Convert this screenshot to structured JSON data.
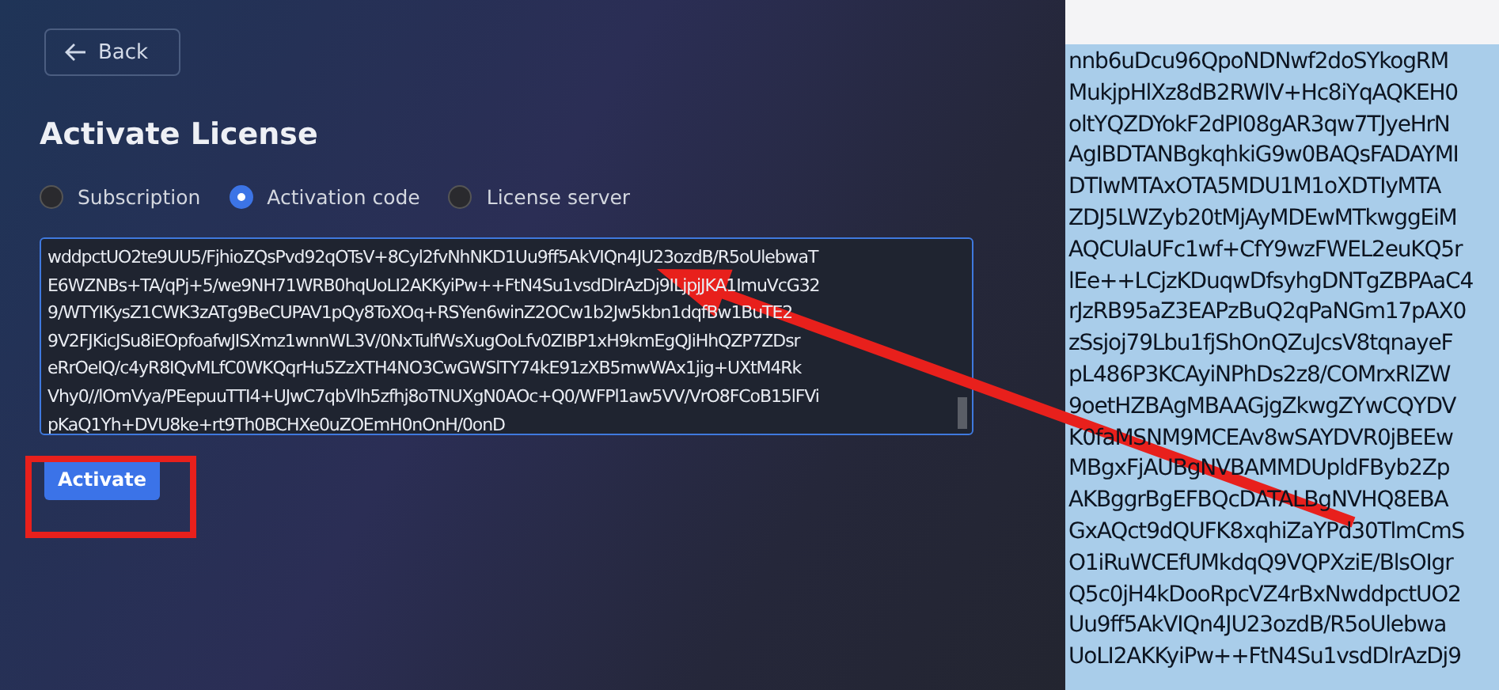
{
  "back_button": {
    "label": "Back"
  },
  "title": "Activate License",
  "license_options": [
    {
      "label": "Subscription",
      "selected": false
    },
    {
      "label": "Activation code",
      "selected": true
    },
    {
      "label": "License server",
      "selected": false
    }
  ],
  "activation_code_field": {
    "lines": [
      "wddpctUO2te9UU5/FjhioZQsPvd92qOTsV+8Cyl2fvNhNKD1Uu9ff5AkVIQn4JU23ozdB/R5oUlebwaT",
      "E6WZNBs+TA/qPj+5/we9NH71WRB0hqUoLI2AKKyiPw++FtN4Su1vsdDlrAzDj9ILjpjJKA1ImuVcG32",
      "9/WTYIKysZ1CWK3zATg9BeCUPAV1pQy8ToXOq+RSYen6winZ2OCw1b2Jw5kbn1dqfBw1BuTE2",
      "9V2FJKicJSu8iEOpfoafwJISXmz1wnnWL3V/0NxTulfWsXugOoLfv0ZIBP1xH9kmEgQJiHhQZP7ZDsr",
      "eRrOeIQ/c4yR8IQvMLfC0WKQqrHu5ZzXTH4NO3CwGWSlTY74kE91zXB5mwWAx1jig+UXtM4Rk",
      "Vhy0//lOmVya/PEepuuTTI4+UJwC7qbVlh5zfhj8oTNUXgN0AOc+Q0/WFPl1aw5VV/VrO8FCoB15lFVi",
      "pKaQ1Yh+DVU8ke+rt9Th0BCHXe0uZOEmH0nOnH/0onD"
    ]
  },
  "activate_button": {
    "label": "Activate"
  },
  "document_lines": [
    "nnb6uDcu96QpoNDNwf2doSYkogRM",
    "MukjpHlXz8dB2RWlV+Hc8iYqAQKEH0",
    "oltYQZDYokF2dPI08gAR3qw7TJyeHrN",
    "AgIBDTANBgkqhkiG9w0BAQsFADAYMI",
    "DTIwMTAxOTA5MDU1M1oXDTIyMTA",
    "ZDJ5LWZyb20tMjAyMDEwMTkwggEiM",
    "AQCUlaUFc1wf+CfY9wzFWEL2euKQ5r",
    "lEe++LCjzKDuqwDfsyhgDNTgZBPAaC4",
    "rJzRB95aZ3EAPzBuQ2qPaNGm17pAX0",
    "zSsjoj79Lbu1fjShOnQZuJcsV8tqnayeF",
    "pL486P3KCAyiNPhDs2z8/COMrxRlZW",
    "9oetHZBAgMBAAGjgZkwgZYwCQYDV",
    "K0faMSNM9MCEAv8wSAYDVR0jBEEw",
    "MBgxFjAUBgNVBAMMDUpldFByb2Zp",
    "AKBggrBgEFBQcDATALBgNVHQ8EBA",
    "GxAQct9dQUFK8xqhiZaYPd30TlmCmS",
    "O1iRuWCEfUMkdqQ9VQPXziE/BlsOIgr",
    "Q5c0jH4kDooRpcVZ4rBxNwddpctUO2",
    "Uu9ff5AkVIQn4JU23ozdB/R5oUlebwa",
    "UoLI2AKKyiPw++FtN4Su1vsdDlrAzDj9"
  ]
}
